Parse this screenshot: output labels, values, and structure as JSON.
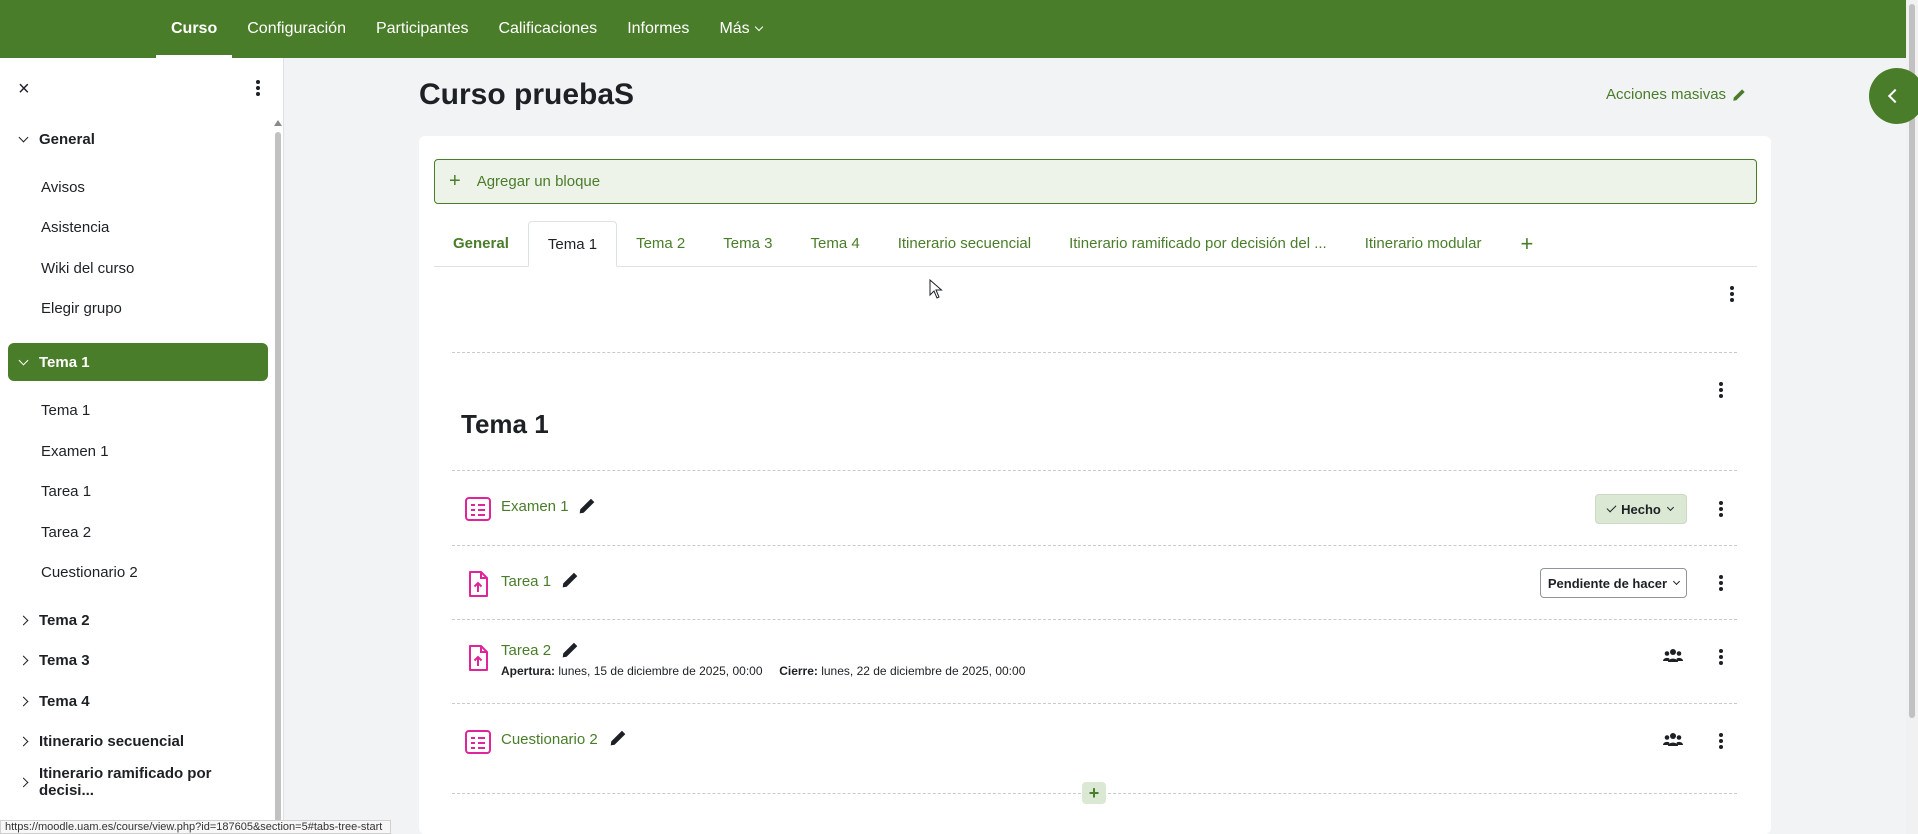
{
  "topnav": {
    "items": [
      {
        "label": "Curso",
        "active": true
      },
      {
        "label": "Configuración"
      },
      {
        "label": "Participantes"
      },
      {
        "label": "Calificaciones"
      },
      {
        "label": "Informes"
      },
      {
        "label": "Más"
      }
    ]
  },
  "sidebar": {
    "close_icon": "×",
    "sections": [
      {
        "label": "General",
        "expanded": true,
        "items": [
          "Avisos",
          "Asistencia",
          "Wiki del curso",
          "Elegir grupo"
        ]
      },
      {
        "label": "Tema 1",
        "expanded": true,
        "active": true,
        "items": [
          "Tema 1",
          "Examen 1",
          "Tarea 1",
          "Tarea 2",
          "Cuestionario 2"
        ]
      },
      {
        "label": "Tema 2"
      },
      {
        "label": "Tema 3"
      },
      {
        "label": "Tema 4"
      },
      {
        "label": "Itinerario secuencial"
      },
      {
        "label": "Itinerario ramificado por decisi..."
      }
    ]
  },
  "status_url": "https://moodle.uam.es/course/view.php?id=187605&section=5#tabs-tree-start",
  "header": {
    "title": "Curso pruebaS",
    "bulk_actions": "Acciones masivas"
  },
  "main": {
    "add_block": "Agregar un bloque",
    "add_block_plus": "+",
    "tabs": [
      {
        "label": "General"
      },
      {
        "label": "Tema 1",
        "active": true
      },
      {
        "label": "Tema 2"
      },
      {
        "label": "Tema 3"
      },
      {
        "label": "Tema 4"
      },
      {
        "label": "Itinerario secuencial"
      },
      {
        "label": "Itinerario ramificado por decisión del ..."
      },
      {
        "label": "Itinerario modular"
      }
    ],
    "tab_add": "+",
    "section_title": "Tema 1",
    "activities": [
      {
        "name": "Examen 1",
        "type": "quiz",
        "completion": "Hecho"
      },
      {
        "name": "Tarea 1",
        "type": "assign",
        "completion": "Pendiente de hacer"
      },
      {
        "name": "Tarea 2",
        "type": "assign",
        "open_label": "Apertura:",
        "open_date": "lunes, 15 de diciembre de 2025, 00:00",
        "close_label": "Cierre:",
        "close_date": "lunes, 22 de diciembre de 2025, 00:00"
      },
      {
        "name": "Cuestionario 2",
        "type": "quiz"
      }
    ],
    "add_section": "+"
  },
  "colors": {
    "brand": "#4a7d2a",
    "activity_icon": "#e0249a"
  }
}
